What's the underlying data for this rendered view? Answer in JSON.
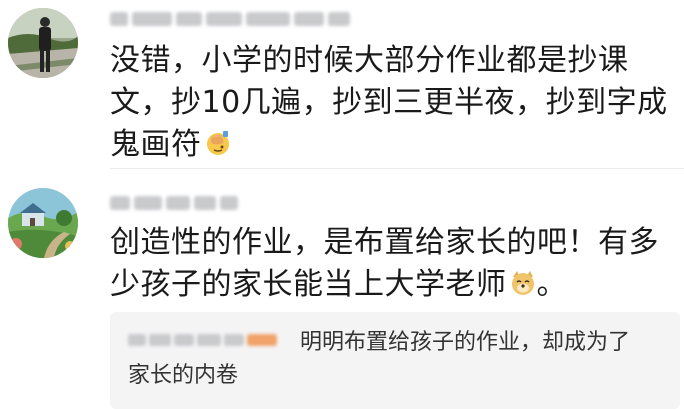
{
  "comments": [
    {
      "avatar": "avatar-person-walking",
      "text": "没错，小学的时候大部分作业都是抄课文，抄10几遍，抄到三更半夜，抄到字成鬼画符",
      "emoji": "facepalm-emoji"
    },
    {
      "avatar": "avatar-house-landscape",
      "text": "创造性的作业，是布置给家长的吧！有多少孩子的家长能当上大学老师",
      "text_end": "。",
      "emoji": "doge-emoji",
      "reply": {
        "text": "明明布置给孩子的作业，却成为了家长的内卷"
      }
    }
  ],
  "colors": {
    "text": "#1a1a1a",
    "reply_background": "#f4f4f5",
    "blurred_name": "#c9cacc",
    "blurred_name_accent": "#f0a36a"
  }
}
